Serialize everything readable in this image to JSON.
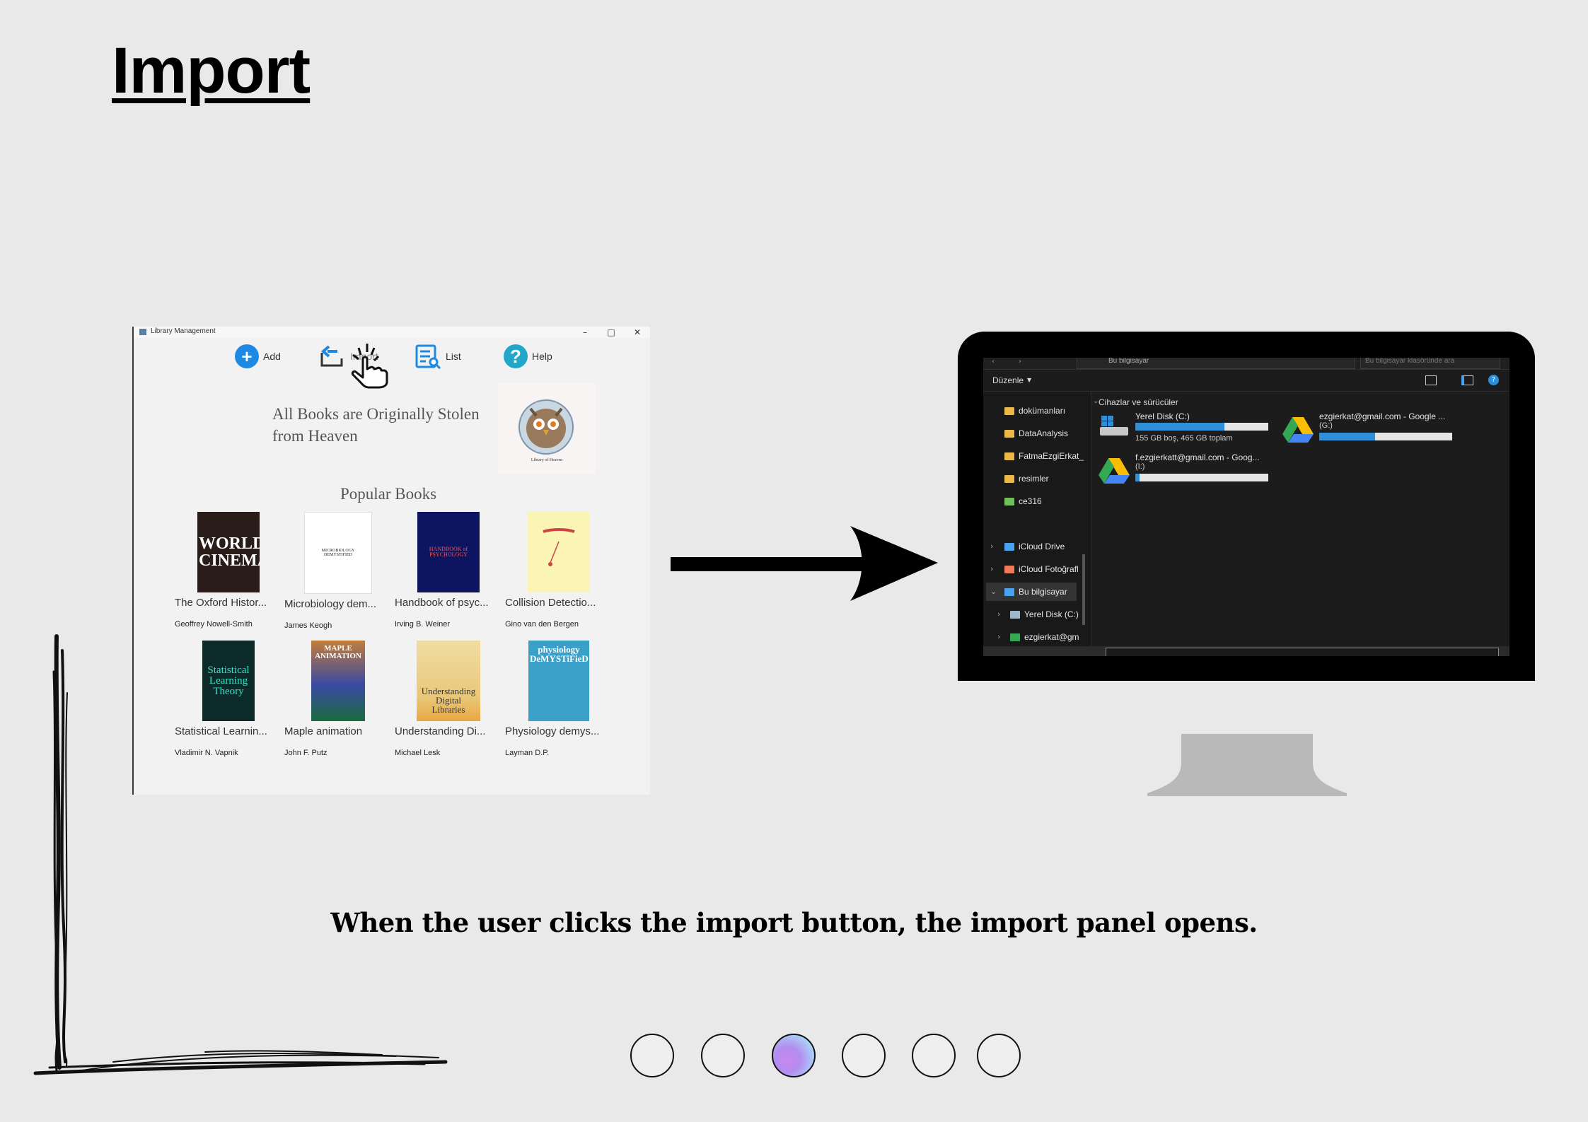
{
  "slide": {
    "title": "Import",
    "caption": "When the user clicks the import button, the import panel opens."
  },
  "app": {
    "window_title": "Library Management",
    "toolbar": {
      "add_label": "Add",
      "import_label": "Import",
      "list_label": "List",
      "help_label": "Help"
    },
    "headline": "All Books are Originally Stolen from Heaven",
    "logo_text": "Library of Heaven",
    "popular_title": "Popular Books",
    "books": [
      {
        "title": "The Oxford Histor...",
        "author": "Geoffrey Nowell-Smith",
        "cover_text": "WORLD CINEMA",
        "cover_color": "#2a1c18"
      },
      {
        "title": "Microbiology dem...",
        "author": "James Keogh",
        "cover_text": "MICROBIOLOGY DEMYSTIFIED",
        "cover_color": "#ffffff"
      },
      {
        "title": "Handbook of psyc...",
        "author": "Irving B. Weiner",
        "cover_text": "HANDBOOK of PSYCHOLOGY",
        "cover_color": "#0e1560"
      },
      {
        "title": "Collision Detectio...",
        "author": "Gino van den Bergen",
        "cover_text": "",
        "cover_color": "#fbf5b5"
      },
      {
        "title": "Statistical Learnin...",
        "author": "Vladimir N. Vapnik",
        "cover_text": "Statistical Learning Theory",
        "cover_color": "#0c2a2a"
      },
      {
        "title": "Maple animation",
        "author": "John F. Putz",
        "cover_text": "MAPLE ANIMATION",
        "cover_color": "#2c3a8a"
      },
      {
        "title": "Understanding Di...",
        "author": "Michael Lesk",
        "cover_text": "Understanding Digital Libraries",
        "cover_color": "#e9a743"
      },
      {
        "title": "Physiology demys...",
        "author": "Layman D.P.",
        "cover_text": "physiology DeMYSTiFieD",
        "cover_color": "#3aa0c8"
      }
    ]
  },
  "explorer": {
    "address": "Bu bilgisayar",
    "search_placeholder": "Bu bilgisayar klasöründe ara",
    "command": "Düzenle",
    "nav_items": [
      "dokümanları",
      "DataAnalysis",
      "FatmaEzgiErkat_",
      "resimler",
      "ce316",
      "iCloud Drive",
      "iCloud Fotoğrafl",
      "Bu bilgisayar",
      "Yerel Disk (C:)",
      "ezgierkat@gm"
    ],
    "section": "Cihazlar ve sürücüler",
    "drives": [
      {
        "name": "Yerel Disk (C:)",
        "info": "155 GB boş, 465 GB toplam",
        "used": 0.67
      },
      {
        "name": "ezgierkat@gmail.com - Google ...",
        "letter": "(G:)",
        "used": 0.42
      },
      {
        "name": "f.ezgierkatt@gmail.com - Goog...",
        "letter": "(I:)",
        "used": 0.03
      }
    ]
  },
  "pagination": {
    "count": 6,
    "active_index": 2
  },
  "colors": {
    "background": "#e9e9e9",
    "accent_blue": "#1e88e5",
    "help_teal": "#22a7c9",
    "explorer_bg": "#1c1c1c"
  }
}
